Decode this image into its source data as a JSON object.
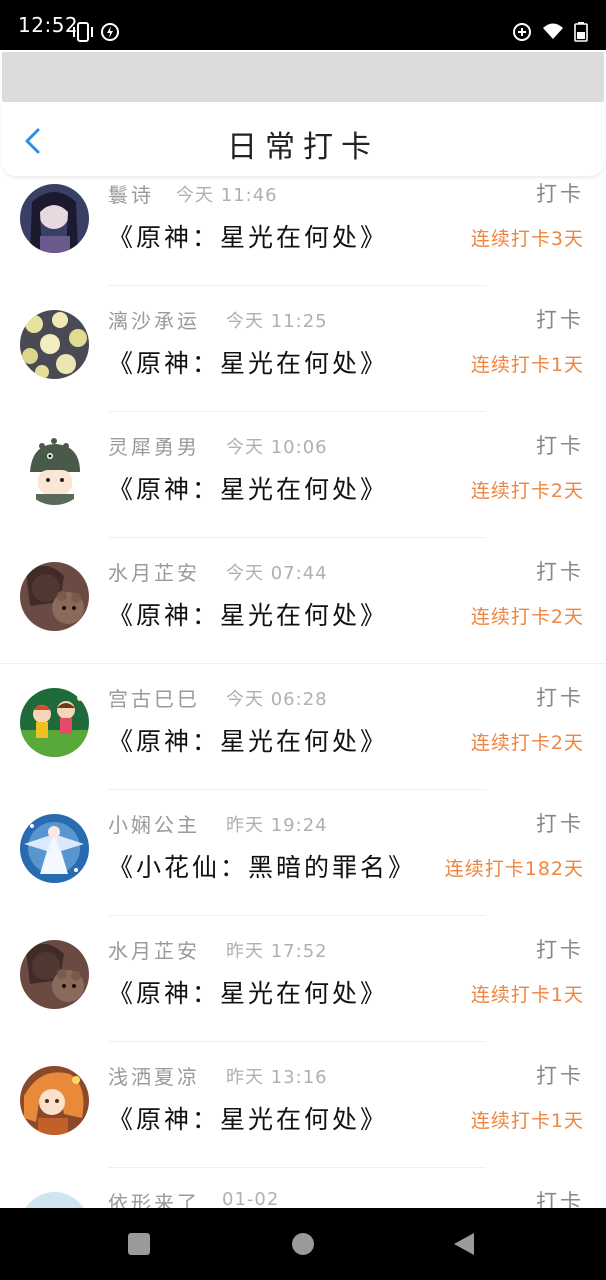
{
  "status_bar": {
    "time": "12:52",
    "icons_left": [
      "vibrate-icon",
      "data-saver-icon"
    ],
    "icons_right": [
      "add-circle-icon",
      "wifi-icon",
      "battery-icon"
    ]
  },
  "header": {
    "title": "日常打卡",
    "back_icon": "chevron-left-icon",
    "accent_color": "#2b8ee6"
  },
  "colors": {
    "streak": "#ef8540",
    "username": "#9a9a9a",
    "title": "#111111"
  },
  "checkins": [
    {
      "username": "鬟诗",
      "time": "今天 11:46",
      "title": "《原神：星光在何处》",
      "action": "打卡",
      "streak": "连续打卡3天",
      "avatar": "dark-hair-anime-girl"
    },
    {
      "username": "漓沙承运",
      "time": "今天 11:25",
      "title": "《原神：星光在何处》",
      "action": "打卡",
      "streak": "连续打卡1天",
      "avatar": "yellow-flower-pattern"
    },
    {
      "username": "灵犀勇男",
      "time": "今天 10:06",
      "title": "《原神：星光在何处》",
      "action": "打卡",
      "streak": "连续打卡2天",
      "avatar": "dinosaur-hat-cartoon"
    },
    {
      "username": "水月芷安",
      "time": "今天 07:44",
      "title": "《原神：星光在何处》",
      "action": "打卡",
      "streak": "连续打卡2天",
      "avatar": "girl-with-teddy-bear"
    },
    {
      "username": "宫古巳巳",
      "time": "今天 06:28",
      "title": "《原神：星光在何处》",
      "action": "打卡",
      "streak": "连续打卡2天",
      "avatar": "cartoon-kids-green"
    },
    {
      "username": "小娴公主",
      "time": "昨天 19:24",
      "title": "《小花仙：黑暗的罪名》",
      "action": "打卡",
      "streak": "连续打卡182天",
      "avatar": "white-fairy-blue-sky"
    },
    {
      "username": "水月芷安",
      "time": "昨天 17:52",
      "title": "《原神：星光在何处》",
      "action": "打卡",
      "streak": "连续打卡1天",
      "avatar": "girl-with-teddy-bear"
    },
    {
      "username": "浅洒夏凉",
      "time": "昨天 13:16",
      "title": "《原神：星光在何处》",
      "action": "打卡",
      "streak": "连续打卡1天",
      "avatar": "orange-hair-anime-girl"
    },
    {
      "username": "依形来了",
      "time": "01-02",
      "title": "",
      "action": "打卡",
      "streak": "",
      "avatar": "pale-blue-avatar"
    }
  ],
  "nav_bar": {
    "buttons": [
      "recents-square-icon",
      "home-circle-icon",
      "back-triangle-icon"
    ]
  }
}
